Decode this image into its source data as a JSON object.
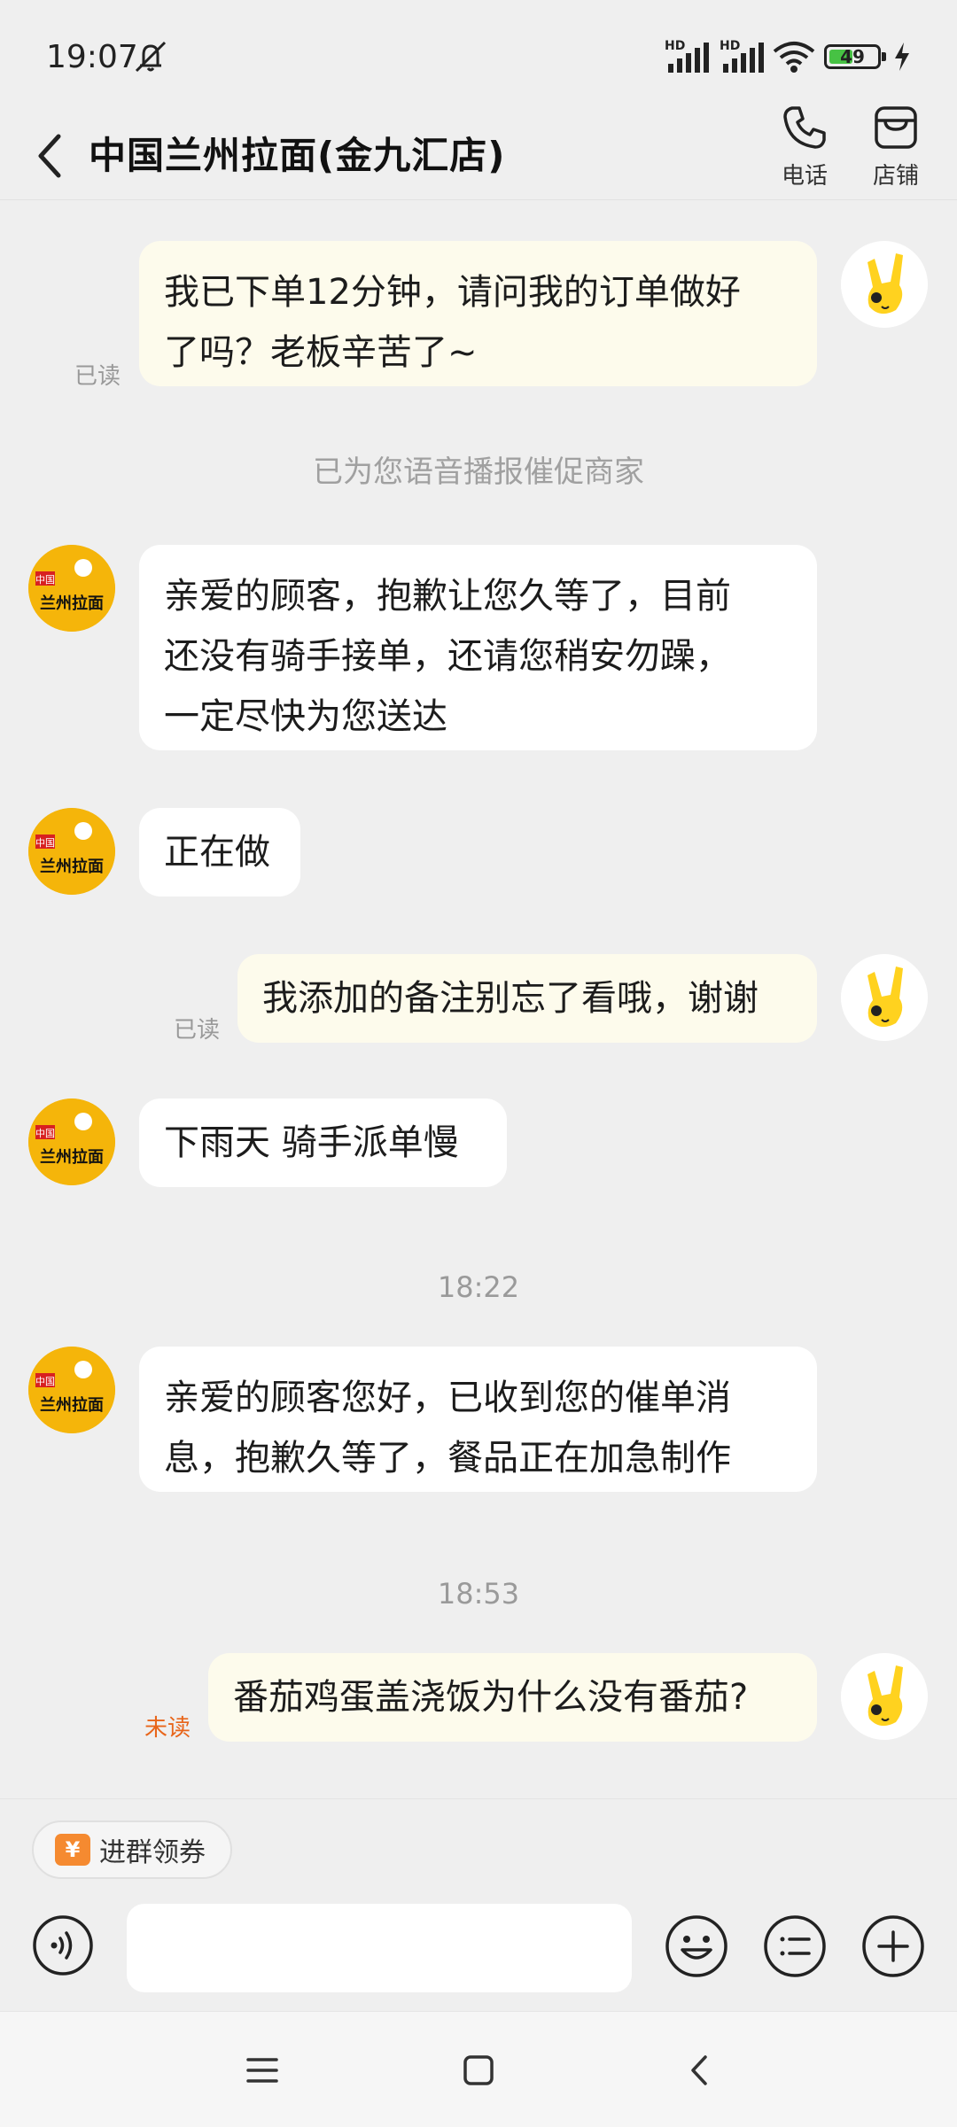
{
  "status_bar": {
    "time": "19:07",
    "battery": "49",
    "signal_label_1": "HD",
    "signal_label_2": "HD"
  },
  "header": {
    "title": "中国兰州拉面(金九汇店)",
    "phone_label": "电话",
    "shop_label": "店铺"
  },
  "messages": [
    {
      "from": "me",
      "text_line1": "我已下单12分钟，请问我的订单做好",
      "text_line2": "了吗？老板辛苦了~",
      "status": "已读"
    },
    {
      "from": "system",
      "text": "已为您语音播报催促商家"
    },
    {
      "from": "shop",
      "text_line1": "亲爱的顾客，抱歉让您久等了，目前",
      "text_line2": "还没有骑手接单，还请您稍安勿躁，",
      "text_line3": "一定尽快为您送达"
    },
    {
      "from": "shop",
      "text": "正在做"
    },
    {
      "from": "me",
      "text": "我添加的备注别忘了看哦，谢谢",
      "status": "已读"
    },
    {
      "from": "shop",
      "text": "下雨天 骑手派单慢"
    },
    {
      "from": "time",
      "text": "18:22"
    },
    {
      "from": "shop",
      "text_line1": "亲爱的顾客您好，已收到您的催单消",
      "text_line2": "息，抱歉久等了，餐品正在加急制作"
    },
    {
      "from": "time",
      "text": "18:53"
    },
    {
      "from": "me",
      "text": "番茄鸡蛋盖浇饭为什么没有番茄?",
      "status": "未读"
    }
  ],
  "shop_avatar": {
    "top": "中国",
    "bottom": "兰州拉面"
  },
  "input": {
    "chip_icon": "¥",
    "chip_label": "进群领券",
    "placeholder": ""
  },
  "colors": {
    "background": "#efefef",
    "my_bubble": "#fdfbec",
    "shop_bubble": "#ffffff",
    "unread": "#e8651a",
    "shop_avatar": "#f5b50a"
  }
}
